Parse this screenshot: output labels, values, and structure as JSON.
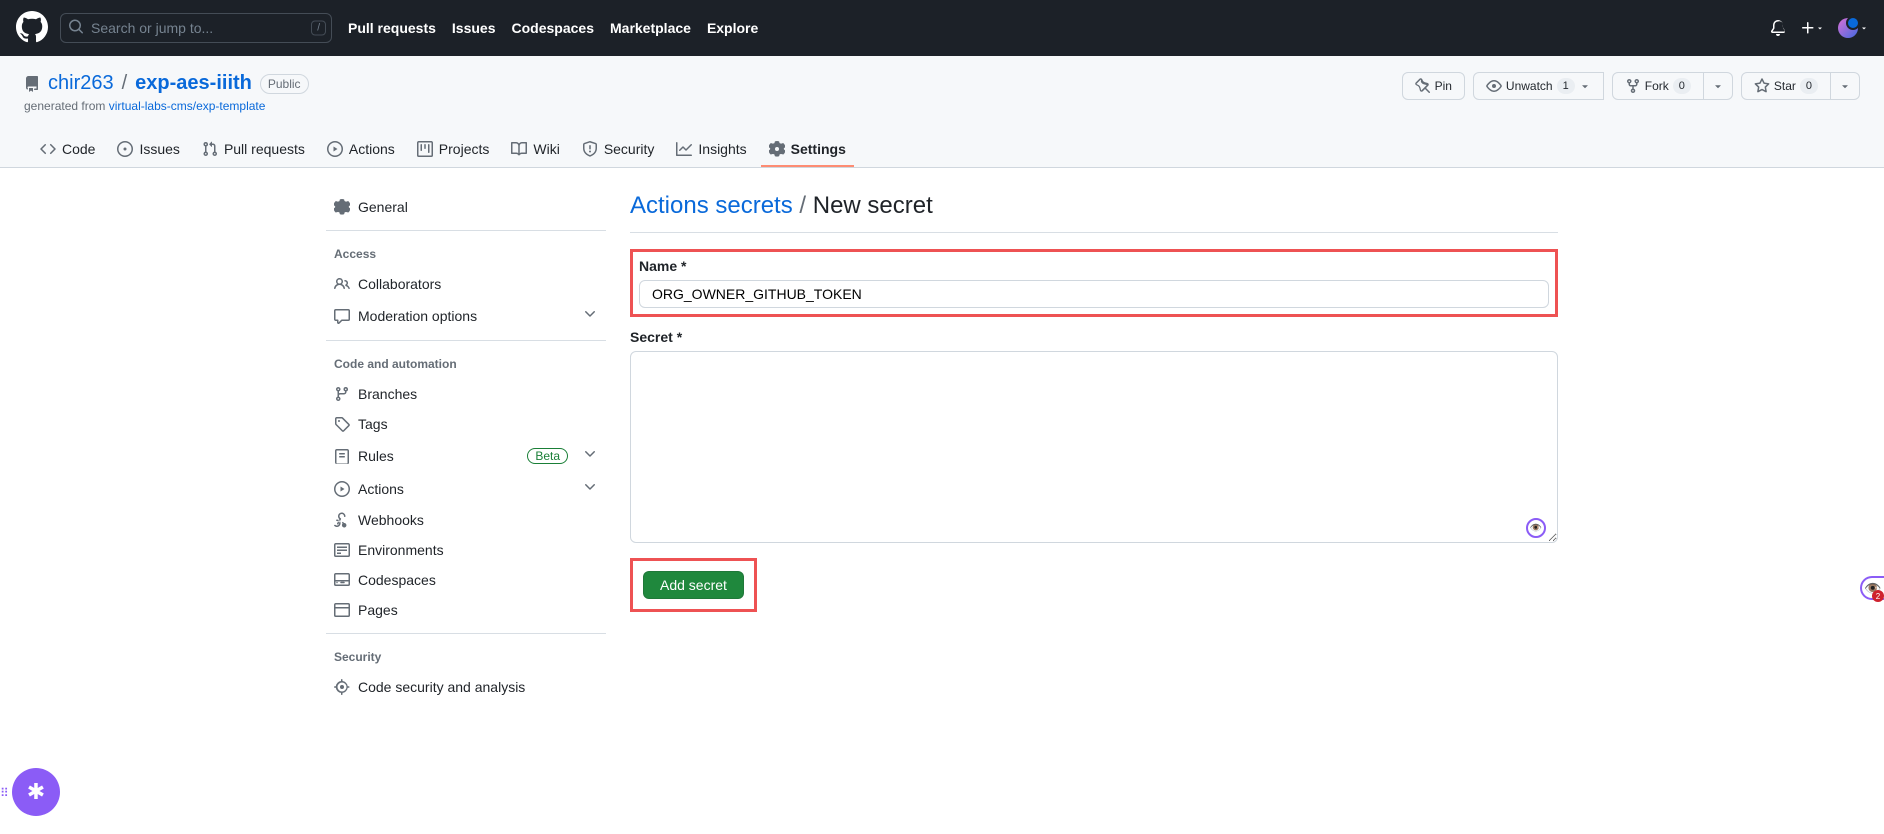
{
  "topnav": {
    "search_placeholder": "Search or jump to...",
    "links": [
      "Pull requests",
      "Issues",
      "Codespaces",
      "Marketplace",
      "Explore"
    ]
  },
  "repo": {
    "owner": "chir263",
    "name": "exp-aes-iiith",
    "visibility": "Public",
    "generated_prefix": "generated from ",
    "generated_link": "virtual-labs-cms/exp-template",
    "actions": {
      "pin": "Pin",
      "unwatch": "Unwatch",
      "unwatch_count": "1",
      "fork": "Fork",
      "fork_count": "0",
      "star": "Star",
      "star_count": "0"
    },
    "tabs": {
      "code": "Code",
      "issues": "Issues",
      "pulls": "Pull requests",
      "actions": "Actions",
      "projects": "Projects",
      "wiki": "Wiki",
      "security": "Security",
      "insights": "Insights",
      "settings": "Settings"
    }
  },
  "sidebar": {
    "general": "General",
    "access_heading": "Access",
    "collaborators": "Collaborators",
    "moderation": "Moderation options",
    "code_heading": "Code and automation",
    "branches": "Branches",
    "tags": "Tags",
    "rules": "Rules",
    "rules_badge": "Beta",
    "actions": "Actions",
    "webhooks": "Webhooks",
    "environments": "Environments",
    "codespaces": "Codespaces",
    "pages": "Pages",
    "security_heading": "Security",
    "code_security": "Code security and analysis"
  },
  "page": {
    "breadcrumb_link": "Actions secrets",
    "breadcrumb_divider": " / ",
    "breadcrumb_current": "New secret",
    "name_label": "Name *",
    "name_value": "ORG_OWNER_GITHUB_TOKEN",
    "secret_label": "Secret *",
    "secret_value": "",
    "add_button": "Add secret"
  },
  "side_badge": "2"
}
